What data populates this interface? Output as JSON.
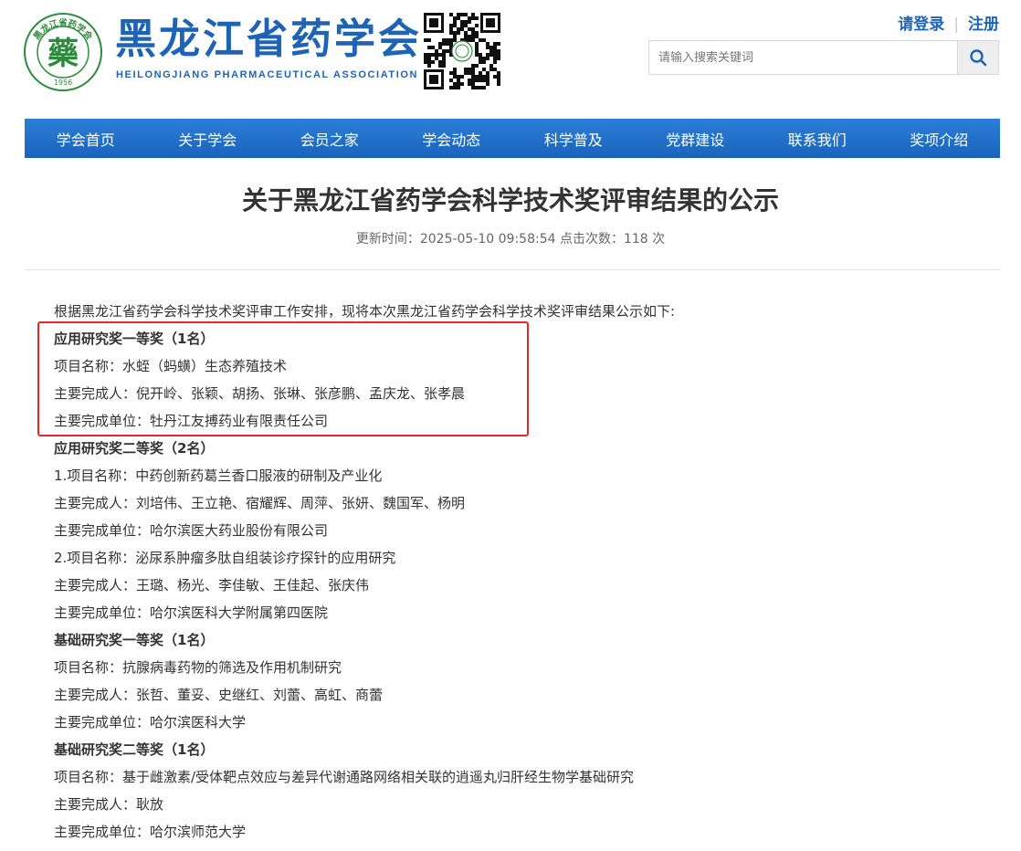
{
  "header": {
    "seal_year": "1956",
    "seal_ring_text": "黑龙江省药学会",
    "seal_glyph": "藥",
    "title": "黑龙江省药学会",
    "subtitle": "HEILONGJIANG PHARMACEUTICAL ASSOCIATION",
    "login_label": "请登录",
    "register_label": "注册",
    "search_placeholder": "请输入搜索关键词",
    "brand_color": "#1f64b4"
  },
  "nav": {
    "items": [
      "学会首页",
      "关于学会",
      "会员之家",
      "学会动态",
      "科学普及",
      "党群建设",
      "联系我们",
      "奖项介绍"
    ]
  },
  "article": {
    "title": "关于黑龙江省药学会科学技术奖评审结果的公示",
    "meta": "更新时间：2025-05-10 09:58:54 点击次数：118 次",
    "lines": [
      {
        "text": "根据黑龙江省药学会科学技术奖评审工作安排，现将本次黑龙江省药学会科学技术奖评审结果公示如下:",
        "bold": false
      },
      {
        "text": "应用研究奖一等奖（1名）",
        "bold": true
      },
      {
        "text": "项目名称：水蛭（蚂蟥）生态养殖技术",
        "bold": false
      },
      {
        "text": "主要完成人：倪开岭、张颖、胡扬、张琳、张彦鹏、孟庆龙、张孝晨",
        "bold": false
      },
      {
        "text": "主要完成单位：牡丹江友搏药业有限责任公司",
        "bold": false
      },
      {
        "text": "应用研究奖二等奖（2名）",
        "bold": true
      },
      {
        "text": "1.项目名称：中药创新药葛兰香口服液的研制及产业化",
        "bold": false
      },
      {
        "text": "主要完成人：刘培伟、王立艳、宿耀辉、周萍、张妍、魏国军、杨明",
        "bold": false
      },
      {
        "text": "主要完成单位：哈尔滨医大药业股份有限公司",
        "bold": false
      },
      {
        "text": "2.项目名称：泌尿系肿瘤多肽自组装诊疗探针的应用研究",
        "bold": false
      },
      {
        "text": "主要完成人：王璐、杨光、李佳敏、王佳起、张庆伟",
        "bold": false
      },
      {
        "text": "主要完成单位：哈尔滨医科大学附属第四医院",
        "bold": false
      },
      {
        "text": "基础研究奖一等奖（1名）",
        "bold": true
      },
      {
        "text": "项目名称：抗腺病毒药物的筛选及作用机制研究",
        "bold": false
      },
      {
        "text": "主要完成人：张哲、董妥、史继红、刘蕾、高虹、商蕾",
        "bold": false
      },
      {
        "text": "主要完成单位：哈尔滨医科大学",
        "bold": false
      },
      {
        "text": "基础研究奖二等奖（1名）",
        "bold": true
      },
      {
        "text": "项目名称：基于雌激素/受体靶点效应与差异代谢通路网络相关联的逍遥丸归肝经生物学基础研究",
        "bold": false
      },
      {
        "text": "主要完成人：耿放",
        "bold": false
      },
      {
        "text": "主要完成单位：哈尔滨师范大学",
        "bold": false
      }
    ]
  }
}
